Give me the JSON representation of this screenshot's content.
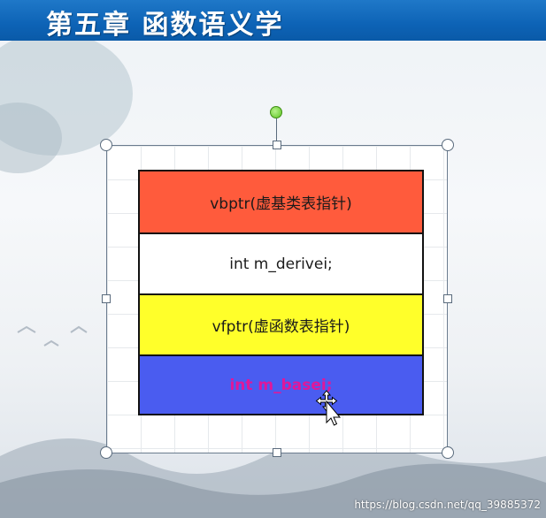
{
  "slide": {
    "title": "第五章 函数语义学"
  },
  "memory_layout": {
    "rows": [
      {
        "label": "vbptr(虚基类表指针)",
        "color": "#ff5b3c"
      },
      {
        "label": "int m_derivei;",
        "color": "#ffffff"
      },
      {
        "label": "vfptr(虚函数表指针)",
        "color": "#ffff2a"
      },
      {
        "label": "int m_basei;",
        "color": "#4a5cf0"
      }
    ]
  },
  "watermark": {
    "text": "https://blog.csdn.net/qq_39885372"
  },
  "icons": {
    "rotate_handle": "rotate-handle-icon",
    "move_cursor": "move-cursor-icon"
  },
  "colors": {
    "title_bar": "#0d63b6",
    "selection_border": "#6b7c8f",
    "rotate_handle": "#5cc521",
    "highlight_text": "#e0179a"
  }
}
